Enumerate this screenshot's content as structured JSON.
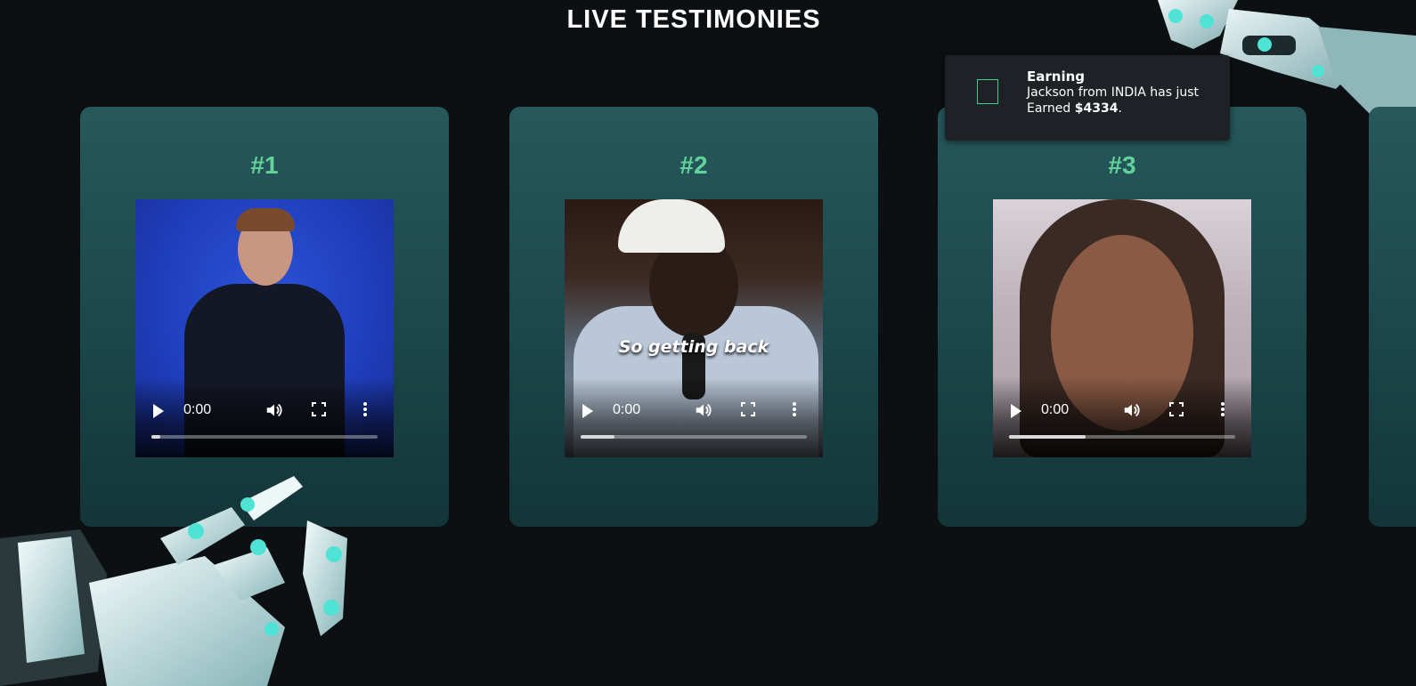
{
  "section": {
    "title": "LIVE TESTIMONIES"
  },
  "cards": [
    {
      "number": "#1",
      "video": {
        "time": "0:00",
        "progress": 0.04
      }
    },
    {
      "number": "#2",
      "video": {
        "time": "0:00",
        "caption": "So getting back",
        "progress": 0.15
      }
    },
    {
      "number": "#3",
      "video": {
        "time": "0:00",
        "progress": 0.34
      }
    }
  ],
  "toast": {
    "title": "Earning",
    "message_prefix": "Jackson from INDIA has just Earned ",
    "amount": "$4334",
    "message_suffix": "."
  },
  "colors": {
    "accent": "#63d29a",
    "card_top": "#26585c",
    "card_bottom": "#133538",
    "background": "#0d1013",
    "toast_bg": "#1e2226"
  },
  "icons": [
    "play-icon",
    "volume-icon",
    "fullscreen-icon",
    "more-options-icon",
    "notification-icon",
    "robot-hand-image"
  ]
}
